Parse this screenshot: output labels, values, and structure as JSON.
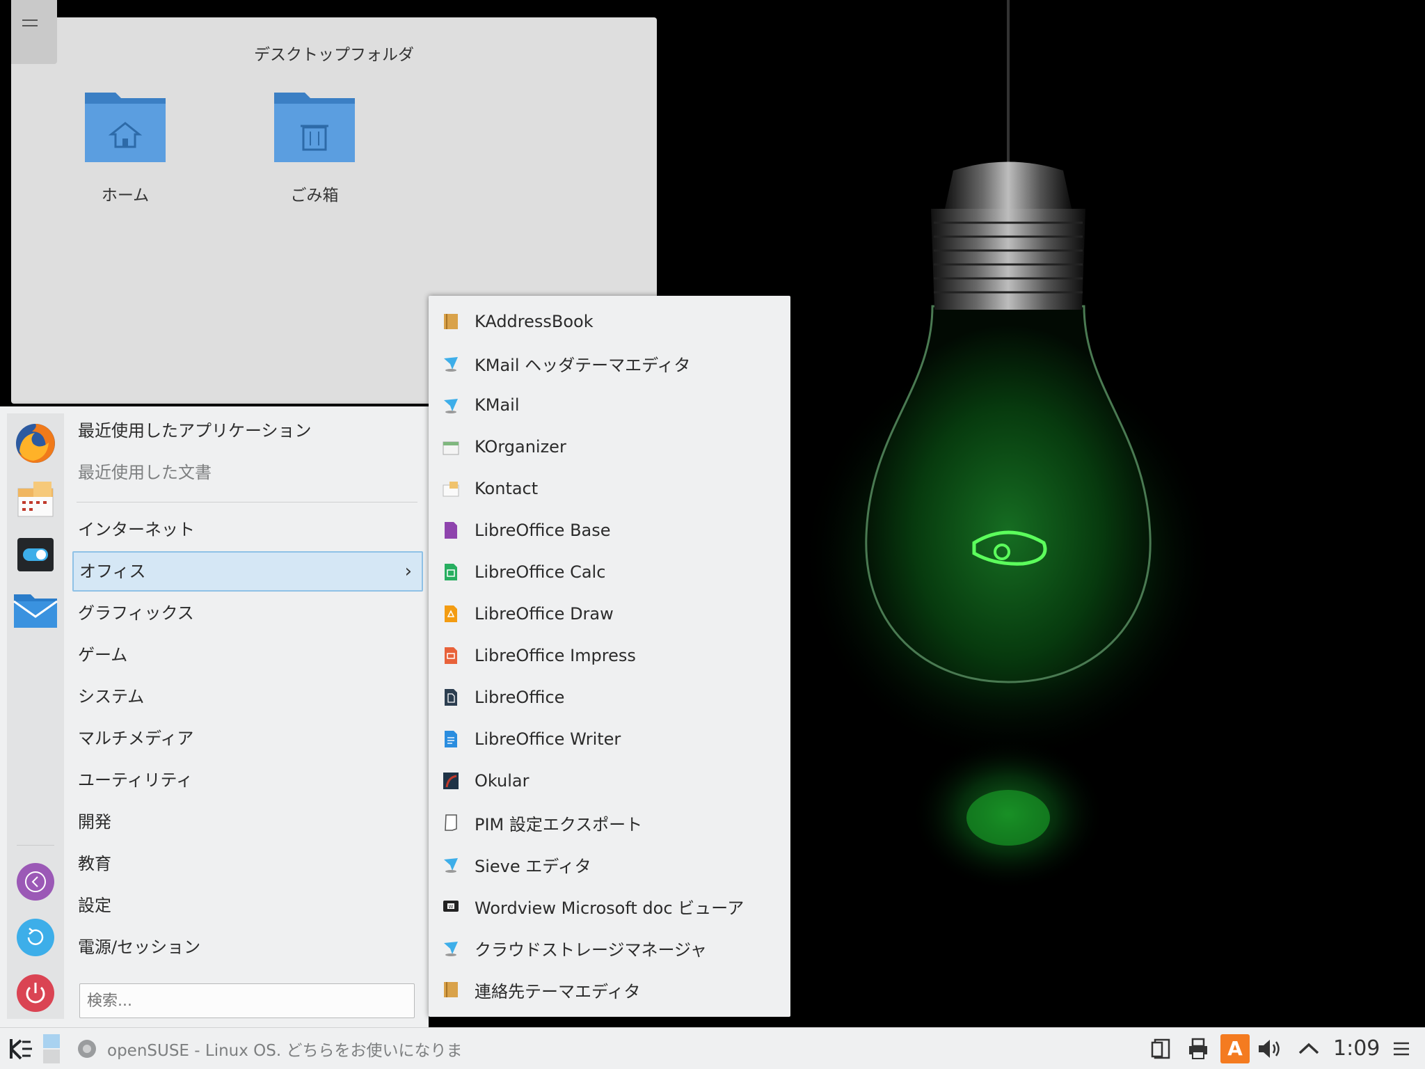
{
  "desktop": {
    "folder_title": "デスクトップフォルダ",
    "icons": [
      {
        "label": "ホーム",
        "icon": "home-folder-icon"
      },
      {
        "label": "ごみ箱",
        "icon": "trash-folder-icon"
      }
    ]
  },
  "launcher": {
    "favorites": [
      {
        "name": "Firefox",
        "icon": "firefox-icon"
      },
      {
        "name": "Calendar",
        "icon": "calendar-icon"
      },
      {
        "name": "System Settings",
        "icon": "toggle-settings-icon"
      },
      {
        "name": "Mail",
        "icon": "mail-icon"
      }
    ],
    "bottom_actions": [
      {
        "name": "Leave",
        "icon": "leave-icon",
        "color": "#9b59b6"
      },
      {
        "name": "Restart",
        "icon": "restart-icon",
        "color": "#3daee9"
      },
      {
        "name": "Shutdown",
        "icon": "power-icon",
        "color": "#da4453"
      }
    ],
    "recent": [
      {
        "label": "最近使用したアプリケーション"
      },
      {
        "label": "最近使用した文書"
      }
    ],
    "categories": [
      {
        "label": "インターネット"
      },
      {
        "label": "オフィス",
        "has_submenu": true
      },
      {
        "label": "グラフィックス"
      },
      {
        "label": "ゲーム"
      },
      {
        "label": "システム"
      },
      {
        "label": "マルチメディア"
      },
      {
        "label": "ユーティリティ"
      },
      {
        "label": "開発"
      },
      {
        "label": "教育"
      },
      {
        "label": "設定"
      },
      {
        "label": "電源/セッション"
      }
    ],
    "search_placeholder": "検索..."
  },
  "office_menu": {
    "items": [
      {
        "label": "KAddressBook",
        "color": "#d9a24a"
      },
      {
        "label": "KMail ヘッダテーマエディタ",
        "color": "#3daee9"
      },
      {
        "label": "KMail",
        "color": "#3daee9"
      },
      {
        "label": "KOrganizer",
        "color": "#7fb77e"
      },
      {
        "label": "Kontact",
        "color": "#f0c36d"
      },
      {
        "label": "LibreOffice Base",
        "color": "#8e44ad"
      },
      {
        "label": "LibreOffice Calc",
        "color": "#27ae60"
      },
      {
        "label": "LibreOffice Draw",
        "color": "#f39c12"
      },
      {
        "label": "LibreOffice Impress",
        "color": "#e67e22"
      },
      {
        "label": "LibreOffice",
        "color": "#2c3e50"
      },
      {
        "label": "LibreOffice Writer",
        "color": "#2a8ddf"
      },
      {
        "label": "Okular",
        "color": "#c0392b"
      },
      {
        "label": "PIM 設定エクスポート",
        "color": "#ffffff"
      },
      {
        "label": "Sieve エディタ",
        "color": "#3daee9"
      },
      {
        "label": "Wordview Microsoft doc ビューア",
        "color": "#222222"
      },
      {
        "label": "クラウドストレージマネージャ",
        "color": "#3daee9"
      },
      {
        "label": "連絡先テーマエディタ",
        "color": "#d9a24a"
      }
    ]
  },
  "taskbar": {
    "launcher_icon": "kde-launcher-icon",
    "pager_icon": "virtual-desktop-icon",
    "task_label": "openSUSE - Linux OS. どちらをお使いになりま",
    "tray_icons": [
      "clipboard-icon",
      "printer-icon",
      "input-method-icon",
      "volume-icon",
      "expand-tray-icon"
    ],
    "input_method_letter": "A",
    "clock": "1:09",
    "menu_icon": "panel-menu-icon"
  }
}
